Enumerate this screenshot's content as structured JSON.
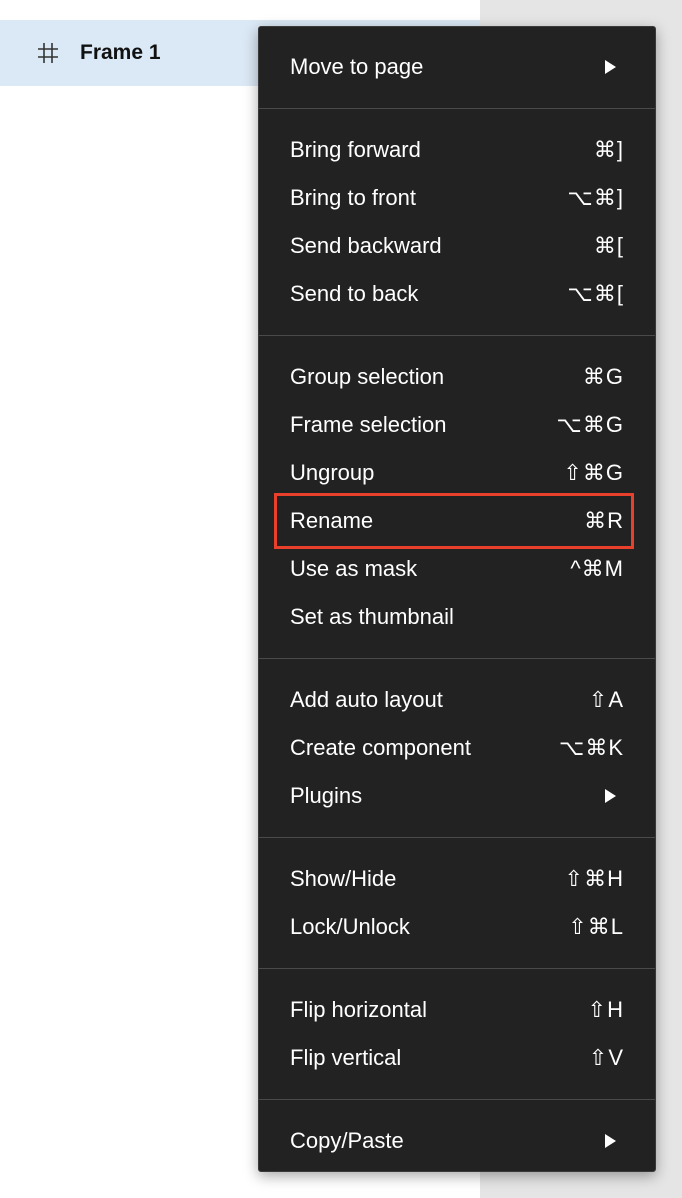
{
  "layer": {
    "name": "Frame 1",
    "icon": "hash-frame-icon"
  },
  "menu": {
    "groups": [
      [
        {
          "label": "Move to page",
          "shortcut": "",
          "submenu": true
        }
      ],
      [
        {
          "label": "Bring forward",
          "shortcut": "⌘]"
        },
        {
          "label": "Bring to front",
          "shortcut": "⌥⌘]"
        },
        {
          "label": "Send backward",
          "shortcut": "⌘["
        },
        {
          "label": "Send to back",
          "shortcut": "⌥⌘["
        }
      ],
      [
        {
          "label": "Group selection",
          "shortcut": "⌘G"
        },
        {
          "label": "Frame selection",
          "shortcut": "⌥⌘G"
        },
        {
          "label": "Ungroup",
          "shortcut": "⇧⌘G"
        },
        {
          "label": "Rename",
          "shortcut": "⌘R"
        },
        {
          "label": "Use as mask",
          "shortcut": "^⌘M"
        },
        {
          "label": "Set as thumbnail",
          "shortcut": ""
        }
      ],
      [
        {
          "label": "Add auto layout",
          "shortcut": "⇧A"
        },
        {
          "label": "Create component",
          "shortcut": "⌥⌘K"
        },
        {
          "label": "Plugins",
          "shortcut": "",
          "submenu": true
        }
      ],
      [
        {
          "label": "Show/Hide",
          "shortcut": "⇧⌘H"
        },
        {
          "label": "Lock/Unlock",
          "shortcut": "⇧⌘L"
        }
      ],
      [
        {
          "label": "Flip horizontal",
          "shortcut": "⇧H"
        },
        {
          "label": "Flip vertical",
          "shortcut": "⇧V"
        }
      ],
      [
        {
          "label": "Copy/Paste",
          "shortcut": "",
          "submenu": true
        }
      ]
    ]
  },
  "highlight": {
    "item": "Rename",
    "color": "#e8402a"
  }
}
